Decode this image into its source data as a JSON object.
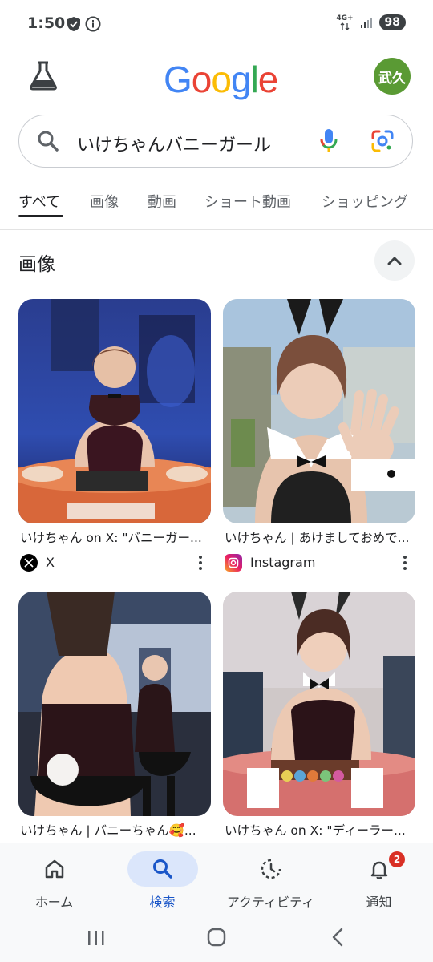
{
  "status_bar": {
    "time": "1:50",
    "network": "4G+",
    "battery": "98"
  },
  "header": {
    "logo": "Google",
    "logo_colors": [
      "#4285F4",
      "#EA4335",
      "#FBBC05",
      "#4285F4",
      "#34A853",
      "#EA4335"
    ],
    "avatar_text": "武久",
    "avatar_color": "#5a9a34"
  },
  "search": {
    "query": "いけちゃんバニーガール"
  },
  "tabs": [
    {
      "label": "すべて",
      "active": true
    },
    {
      "label": "画像",
      "active": false
    },
    {
      "label": "動画",
      "active": false
    },
    {
      "label": "ショート動画",
      "active": false
    },
    {
      "label": "ショッピング",
      "active": false
    }
  ],
  "images_section": {
    "title": "画像",
    "results": [
      {
        "caption": "いけちゃん on X: \"バニーガー...",
        "source": "X",
        "source_icon": "x-logo-icon"
      },
      {
        "caption": "いけちゃん | あけましておめで...",
        "source": "Instagram",
        "source_icon": "instagram-logo-icon"
      },
      {
        "caption": "いけちゃん | バニーちゃん🥰...",
        "source": "",
        "source_icon": ""
      },
      {
        "caption": "いけちゃん on X: \"ディーラー...",
        "source": "",
        "source_icon": ""
      }
    ]
  },
  "bottom_nav": {
    "items": [
      {
        "label": "ホーム",
        "icon": "home-icon"
      },
      {
        "label": "検索",
        "icon": "search-icon",
        "active": true
      },
      {
        "label": "アクティビティ",
        "icon": "activity-icon"
      },
      {
        "label": "通知",
        "icon": "bell-icon",
        "badge": "2"
      }
    ]
  },
  "colors": {
    "accent": "#1a56c8",
    "active_nav_bg": "#dbe6fb",
    "badge": "#d93025"
  }
}
